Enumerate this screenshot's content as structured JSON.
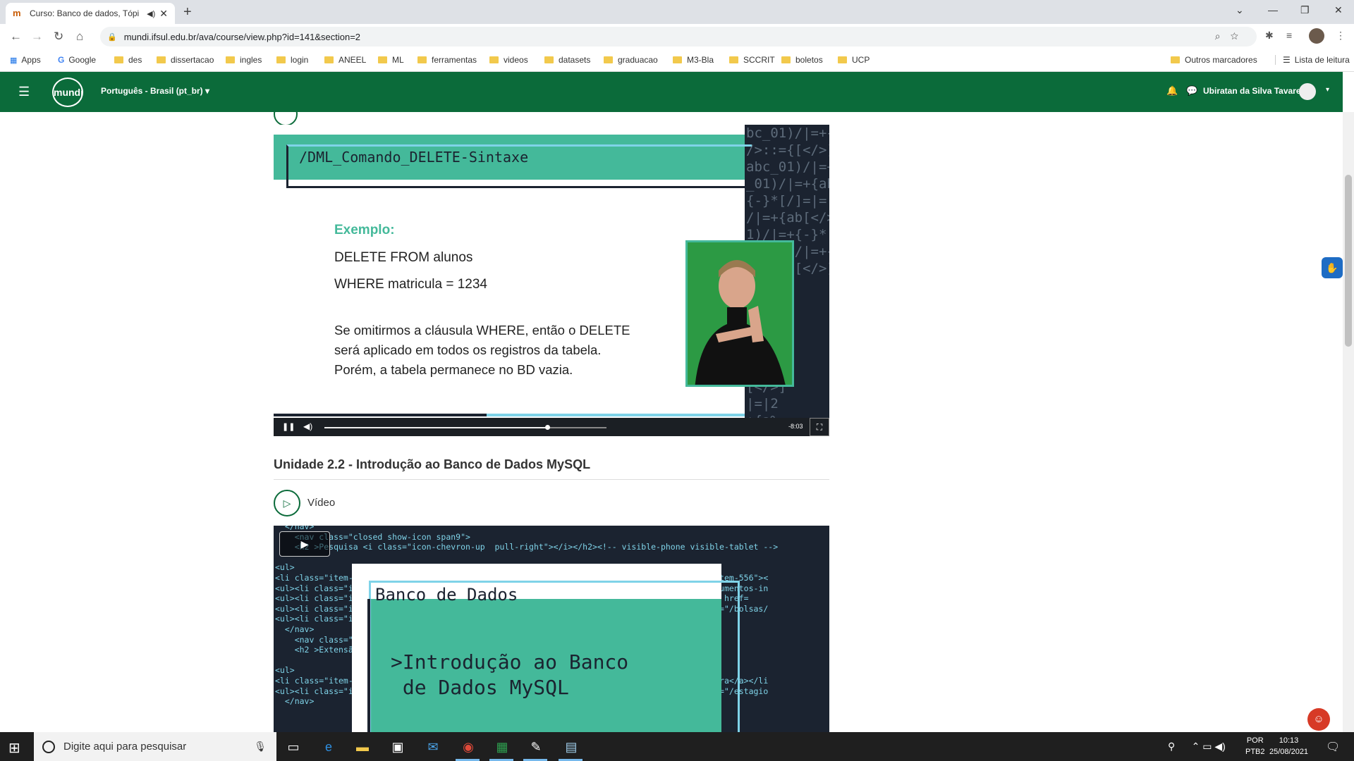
{
  "browser": {
    "tab_title": "Curso: Banco de dados, Tópi",
    "url": "mundi.ifsul.edu.br/ava/course/view.php?id=141&section=2"
  },
  "bookmarks": {
    "apps": "Apps",
    "items": [
      "Google",
      "des",
      "dissertacao",
      "ingles",
      "login",
      "ANEEL",
      "ML",
      "ferramentas",
      "videos",
      "datasets",
      "graduacao",
      "M3-Bla",
      "SCCRIT",
      "boletos",
      "UCP"
    ],
    "other": "Outros marcadores",
    "reading_list": "Lista de leitura"
  },
  "header": {
    "logo": "mundi",
    "language": "Português - Brasil (pt_br)",
    "user_name": "Ubiratan da Silva Tavares"
  },
  "video1": {
    "slide_title": "/DML_Comando_DELETE-Sintaxe",
    "example_label": "Exemplo:",
    "sql_line1": "DELETE FROM alunos",
    "sql_line2": "WHERE matricula = 1234",
    "paragraph": "Se omitirmos a cláusula WHERE, então o DELETE será aplicado em todos os registros da tabela. Porém, a tabela permanece no BD vazia.",
    "code_background": "bc_01)/|=+{\n/>::={[</>]*\nabc_01)/|=+{\n_01)/|=+{ab\n{-}*[/]=|=|2\n/|=+{ab[</>]\n1)/|=+{-}*[]\nbc_01)/|=+{\n/>::={[</>]*\n/|=+{\n[</>]\n|=|2\n+{a%\n</>]*\n/|=+{\n[</>]\n|=|2\n+{a%\nbc_01)/|=+{\n/>::={[</>]*\nbc_01",
    "time_remaining": "-8:03",
    "progress_fraction": 0.79
  },
  "unit": {
    "heading": "Unidade 2.2 - Introdução ao Banco de Dados MySQL",
    "activity_label": "Vídeo"
  },
  "video2": {
    "code_text": "  </nav>\n    <nav class=\"closed show-icon span9\">\n    <h2 >Pesquisa <i class=\"icon-chevron-up  pull-right\"></i></h2><!-- visible-phone visible-tablet -->\n\n<ul>\n<li class=\"item-                                                               <li class=\"item-556\"><\n<ul><li class=\"i                                                               inovacao/documentos-in\n<ul><li class=\"i                                                               item-551\"><a href=\n<ul><li class=\"i                                                               470\"><a href=\"/bolsas/\n<ul><li class=\"i\n  </nav>\n    <nav class=\"\n    <h2 >Extensã                                                                -tablet -->\n\n<ul>\n<li class=\"item-                                                               tura\" >Cultura</a></li\n<ul><li class=\"i                                                               -48\"><a href=\"/estagio\n  </nav>",
    "slide_title": "Banco de Dados",
    "slide_subtitle_line1": ">Introdução ao Banco",
    "slide_subtitle_line2": " de Dados MySQL"
  },
  "taskbar": {
    "search_placeholder": "Digite aqui para pesquisar",
    "lang_line1": "POR",
    "lang_line2": "PTB2",
    "time": "10:13",
    "date": "25/08/2021"
  },
  "colors": {
    "brand_green": "#0b6b3a",
    "slide_teal": "#44b99a",
    "slide_dark": "#1b2330",
    "slide_cyan": "#7fd3e8"
  }
}
